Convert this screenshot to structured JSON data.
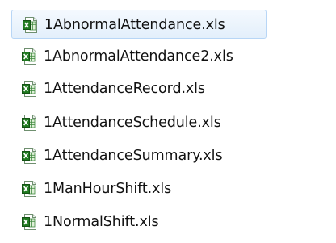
{
  "selection_color": "#e3effb",
  "files": [
    {
      "name": "1AbnormalAttendance.xls",
      "icon": "excel-file-icon",
      "selected": true
    },
    {
      "name": "1AbnormalAttendance2.xls",
      "icon": "excel-file-icon",
      "selected": false
    },
    {
      "name": "1AttendanceRecord.xls",
      "icon": "excel-file-icon",
      "selected": false
    },
    {
      "name": "1AttendanceSchedule.xls",
      "icon": "excel-file-icon",
      "selected": false
    },
    {
      "name": "1AttendanceSummary.xls",
      "icon": "excel-file-icon",
      "selected": false
    },
    {
      "name": "1ManHourShift.xls",
      "icon": "excel-file-icon",
      "selected": false
    },
    {
      "name": "1NormalShift.xls",
      "icon": "excel-file-icon",
      "selected": false
    }
  ]
}
